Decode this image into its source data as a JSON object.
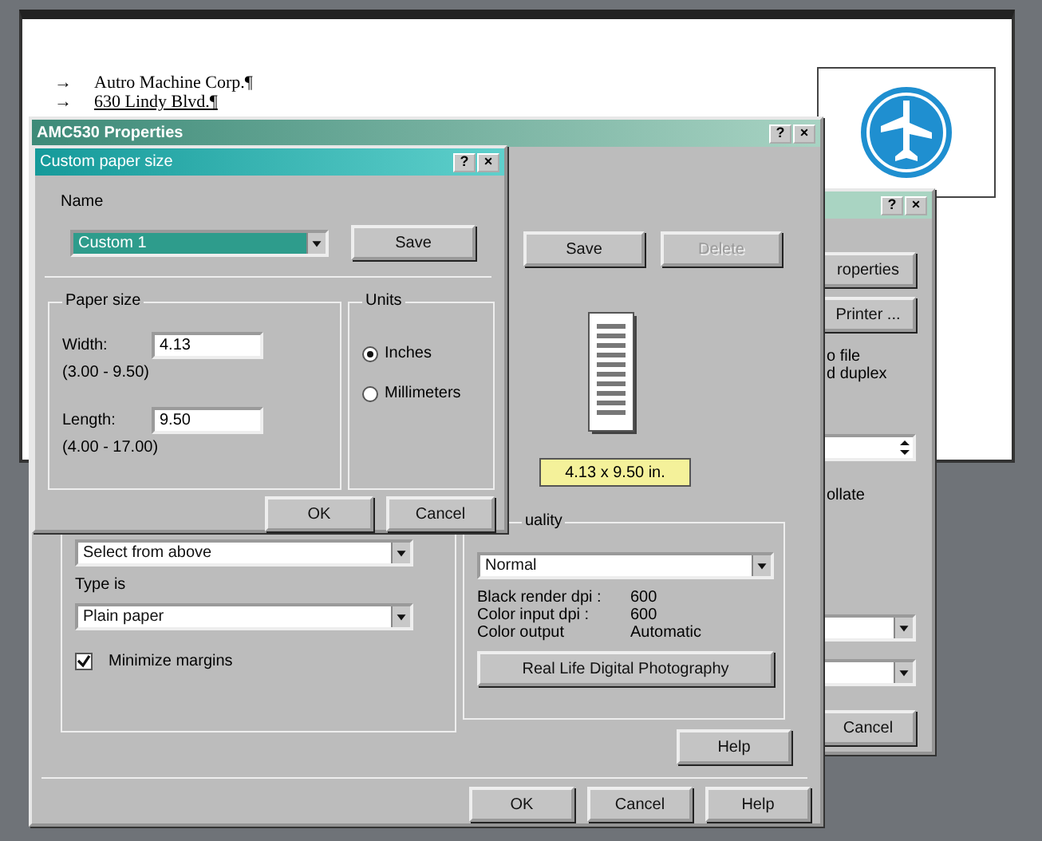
{
  "document": {
    "lines": [
      {
        "marker": "→",
        "text": "Autro Machine Corp.¶"
      },
      {
        "marker": "→",
        "text": "630 Lindy Blvd.¶"
      }
    ]
  },
  "printer_dialog": {
    "title_buttons": [
      "?",
      "×"
    ],
    "buttons": [
      "roperties",
      "Printer ..."
    ],
    "texts": [
      "o file",
      "d duplex"
    ],
    "collate": "ollate",
    "cancel": "Cancel"
  },
  "properties_dialog": {
    "title": "AMC530 Properties",
    "title_buttons": [
      "?",
      "×"
    ],
    "buttons": [
      {
        "label": "Save",
        "disabled": false
      },
      {
        "label": "Delete",
        "disabled": true
      }
    ],
    "preview_label": "4.13 x 9.50 in.",
    "source": {
      "value": "Select from above"
    },
    "type": {
      "label": "Type is",
      "value": "Plain paper"
    },
    "minimize_margins": {
      "label": "Minimize margins",
      "checked": true
    },
    "quality": {
      "label": "uality",
      "value": "Normal",
      "info": [
        {
          "name": "Black render dpi :",
          "value": "600"
        },
        {
          "name": "Color input dpi :",
          "value": "600"
        },
        {
          "name": "Color output",
          "value": "Automatic"
        }
      ],
      "button": "Real Life Digital Photography"
    },
    "help": "Help",
    "footer": [
      "OK",
      "Cancel",
      "Help"
    ]
  },
  "custom_dialog": {
    "title": "Custom paper size",
    "title_buttons": [
      "?",
      "×"
    ],
    "name": {
      "label": "Name",
      "value": "Custom 1",
      "highlighted": true,
      "save": "Save"
    },
    "paper_size": {
      "label": "Paper size",
      "fields": [
        {
          "label": "Width:",
          "value": "4.13",
          "range": "(3.00 - 9.50)"
        },
        {
          "label": "Length:",
          "value": "9.50",
          "range": "(4.00 - 17.00)"
        }
      ]
    },
    "units": {
      "label": "Units",
      "options": [
        {
          "label": "Inches",
          "selected": true
        },
        {
          "label": "Millimeters",
          "selected": false
        }
      ]
    },
    "buttons": [
      "OK",
      "Cancel"
    ]
  }
}
